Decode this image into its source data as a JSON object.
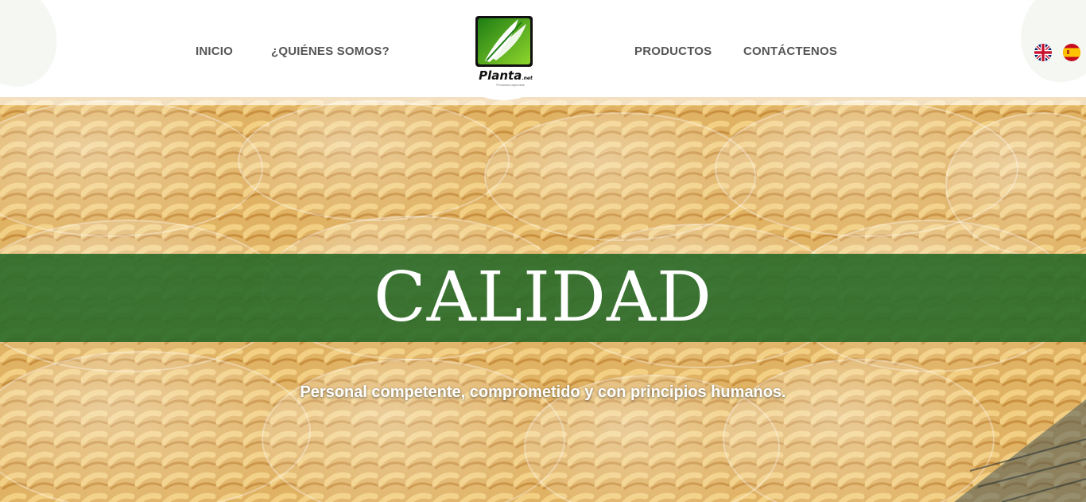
{
  "nav": {
    "inicio": "INICIO",
    "quienes": "¿QUIÉNES SOMOS?",
    "productos": "PRODUCTOS",
    "contacto": "CONTÁCTENOS"
  },
  "logo": {
    "brand": "Planta",
    "brand_suffix": ".net",
    "subtitle": "Productos agrícolas",
    "colors": {
      "green": "#2e9a1e",
      "lime": "#7fd02a",
      "black": "#111111"
    }
  },
  "languages": [
    {
      "code": "en",
      "icon": "uk-flag-icon"
    },
    {
      "code": "es",
      "icon": "spain-flag-icon"
    }
  ],
  "hero": {
    "title": "CALIDAD",
    "tagline": "Personal competente, comprometido y con principios humanos.",
    "banner_color": "#286928"
  }
}
